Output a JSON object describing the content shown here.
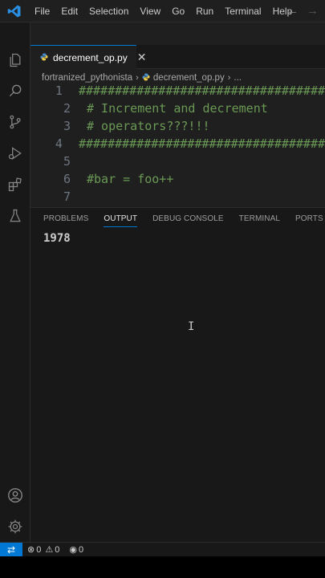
{
  "menu": [
    "File",
    "Edit",
    "Selection",
    "View",
    "Go",
    "Run",
    "Terminal",
    "Help"
  ],
  "nav": {
    "back": "←",
    "forward": "→"
  },
  "tab": {
    "label": "decrement_op.py",
    "close": "✕"
  },
  "breadcrumb": {
    "folder": "fortranized_pythonista",
    "file": "decrement_op.py",
    "more": "..."
  },
  "editor": {
    "lines": [
      {
        "num": "1",
        "text": "##################################"
      },
      {
        "num": "2",
        "text": "# Increment and decrement"
      },
      {
        "num": "3",
        "text": "# operators???!!!"
      },
      {
        "num": "4",
        "text": "##################################"
      },
      {
        "num": "5",
        "text": ""
      },
      {
        "num": "6",
        "text": "#bar = foo++"
      },
      {
        "num": "7",
        "text": ""
      }
    ]
  },
  "panel": {
    "tabs": [
      "PROBLEMS",
      "OUTPUT",
      "DEBUG CONSOLE",
      "TERMINAL",
      "PORTS"
    ],
    "active_tab": "OUTPUT",
    "output": "1978"
  },
  "status": {
    "errors": "0",
    "warnings": "0",
    "ports": "0"
  },
  "colors": {
    "accent": "#0078d4",
    "comment": "#6a9955",
    "background": "#1f1f1f"
  },
  "icons": [
    "vscode-logo-icon",
    "explorer-icon",
    "search-icon",
    "source-control-icon",
    "run-debug-icon",
    "extensions-icon",
    "testing-icon",
    "account-icon",
    "settings-gear-icon"
  ]
}
